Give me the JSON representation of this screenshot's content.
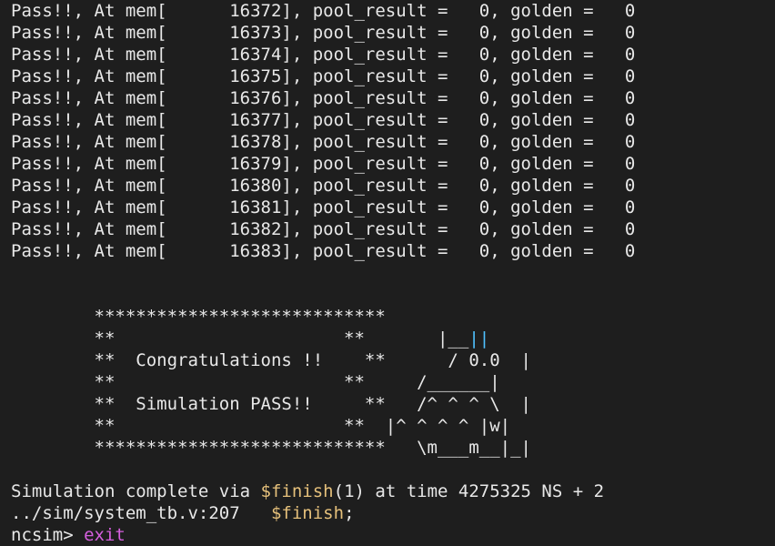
{
  "terminal": {
    "log_lines": [
      "Pass!!, At mem[      16372], pool_result =   0, golden =   0",
      "Pass!!, At mem[      16373], pool_result =   0, golden =   0",
      "Pass!!, At mem[      16374], pool_result =   0, golden =   0",
      "Pass!!, At mem[      16375], pool_result =   0, golden =   0",
      "Pass!!, At mem[      16376], pool_result =   0, golden =   0",
      "Pass!!, At mem[      16377], pool_result =   0, golden =   0",
      "Pass!!, At mem[      16378], pool_result =   0, golden =   0",
      "Pass!!, At mem[      16379], pool_result =   0, golden =   0",
      "Pass!!, At mem[      16380], pool_result =   0, golden =   0",
      "Pass!!, At mem[      16381], pool_result =   0, golden =   0",
      "Pass!!, At mem[      16382], pool_result =   0, golden =   0",
      "Pass!!, At mem[      16383], pool_result =   0, golden =   0"
    ],
    "banner": {
      "line1_pre": "        ****************************",
      "line2_pre": "        **                      **       |__",
      "line2_cyan": "||",
      "line3_pre": "        **  Congratulations !!    **      / 0.0  |",
      "line4_pre": "        **                      **     /______|",
      "line5_pre": "        **  Simulation PASS!!     **   /^ ^ ^ \\  |",
      "line6_pre": "        **                      **  |^ ^ ^ ^ |w|",
      "line7_pre": "        ****************************   \\m___m__|_|"
    },
    "sim_complete": {
      "pre": "Simulation complete via ",
      "finish": "$finish",
      "post": "(1) at time 4275325 NS + 2"
    },
    "source_loc": {
      "pre": "../sim/system_tb.v:207   ",
      "finish": "$finish",
      "post": ";"
    },
    "prompt": {
      "text": "ncsim> ",
      "command": "exit"
    },
    "colors": {
      "background": "#1e1e1e",
      "foreground": "#e8e8e8",
      "finish_keyword": "#e5c07b",
      "command": "#d55fde",
      "ascii_accent": "#4fc1ff"
    }
  }
}
